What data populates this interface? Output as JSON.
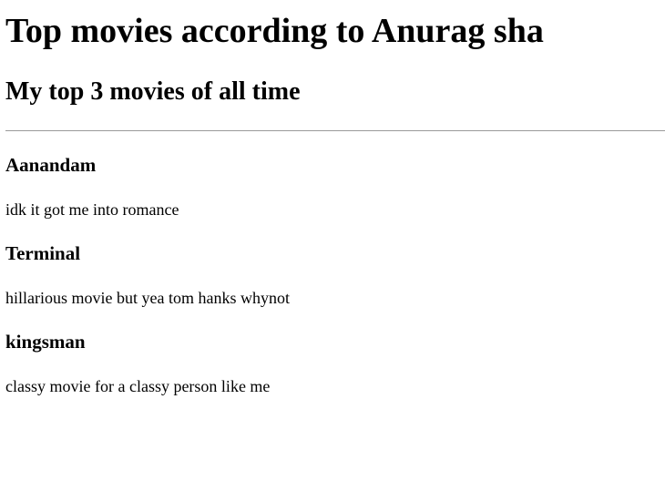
{
  "page": {
    "title": "Top movies according to Anurag sha",
    "subtitle": "My top 3 movies of all time"
  },
  "movies": [
    {
      "title": "Aanandam",
      "description": "idk it got me into romance"
    },
    {
      "title": "Terminal",
      "description": "hillarious movie but yea tom hanks whynot"
    },
    {
      "title": "kingsman",
      "description": "classy movie for a classy person like me"
    }
  ]
}
